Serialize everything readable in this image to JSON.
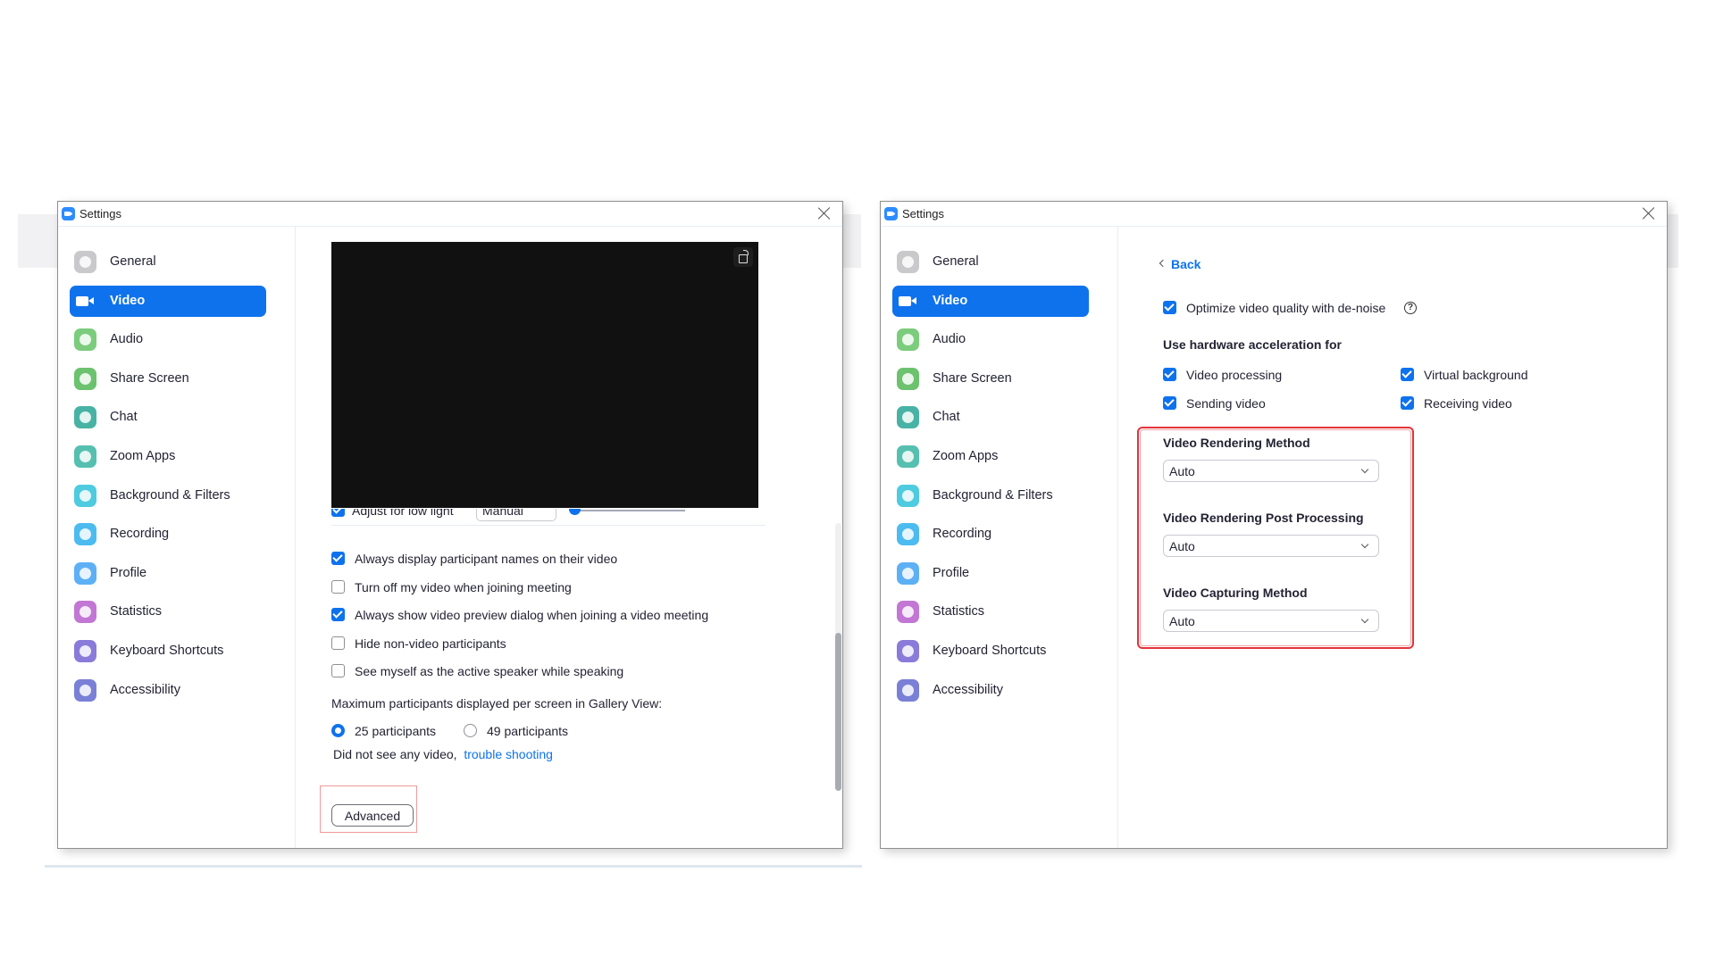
{
  "colors": {
    "accent": "#0e72ed",
    "highlight_box": "#e5323a"
  },
  "sidebar_items": [
    {
      "label": "General",
      "icon": "gear-icon",
      "color": "#c9c9cc"
    },
    {
      "label": "Video",
      "icon": "video-camera-icon",
      "color": "#0e72ed",
      "active": true
    },
    {
      "label": "Audio",
      "icon": "headphones-icon",
      "color": "#7ccc7d"
    },
    {
      "label": "Share Screen",
      "icon": "share-screen-icon",
      "color": "#6cc26e"
    },
    {
      "label": "Chat",
      "icon": "chat-bubble-icon",
      "color": "#48b3a4"
    },
    {
      "label": "Zoom Apps",
      "icon": "zoom-apps-icon",
      "color": "#56c0b0"
    },
    {
      "label": "Background & Filters",
      "icon": "background-filters-icon",
      "color": "#4fcbdf"
    },
    {
      "label": "Recording",
      "icon": "recording-icon",
      "color": "#4cbbf0"
    },
    {
      "label": "Profile",
      "icon": "profile-icon",
      "color": "#5eb0f5"
    },
    {
      "label": "Statistics",
      "icon": "statistics-icon",
      "color": "#c177d3"
    },
    {
      "label": "Keyboard Shortcuts",
      "icon": "keyboard-icon",
      "color": "#8a7ad9"
    },
    {
      "label": "Accessibility",
      "icon": "accessibility-icon",
      "color": "#7a80d6"
    }
  ],
  "left_window": {
    "title": "Settings",
    "low_light": {
      "label": "Adjust for low light",
      "checked": true,
      "mode": "Manual",
      "level": 0.0
    },
    "options": [
      {
        "label": "Always display participant names on their video",
        "checked": true
      },
      {
        "label": "Turn off my video when joining meeting",
        "checked": false
      },
      {
        "label": "Always show video preview dialog when joining a video meeting",
        "checked": true
      },
      {
        "label": "Hide non-video participants",
        "checked": false
      },
      {
        "label": "See myself as the active speaker while speaking",
        "checked": false
      }
    ],
    "gallery_label": "Maximum participants displayed per screen in Gallery View:",
    "gallery_options": [
      {
        "label": "25 participants",
        "selected": true
      },
      {
        "label": "49 participants",
        "selected": false
      }
    ],
    "trouble_text": "Did not see any video,",
    "trouble_link": "trouble shooting",
    "advanced_button": "Advanced"
  },
  "right_window": {
    "title": "Settings",
    "back_label": "Back",
    "denoise": {
      "label": "Optimize video quality with de-noise",
      "checked": true,
      "help": "?"
    },
    "hw_header": "Use hardware acceleration for",
    "hw_options": [
      {
        "label": "Video processing",
        "checked": true
      },
      {
        "label": "Virtual background",
        "checked": true
      },
      {
        "label": "Sending video",
        "checked": true
      },
      {
        "label": "Receiving video",
        "checked": true
      }
    ],
    "dropdowns": [
      {
        "label": "Video Rendering Method",
        "value": "Auto"
      },
      {
        "label": "Video Rendering Post Processing",
        "value": "Auto"
      },
      {
        "label": "Video Capturing Method",
        "value": "Auto"
      }
    ]
  }
}
